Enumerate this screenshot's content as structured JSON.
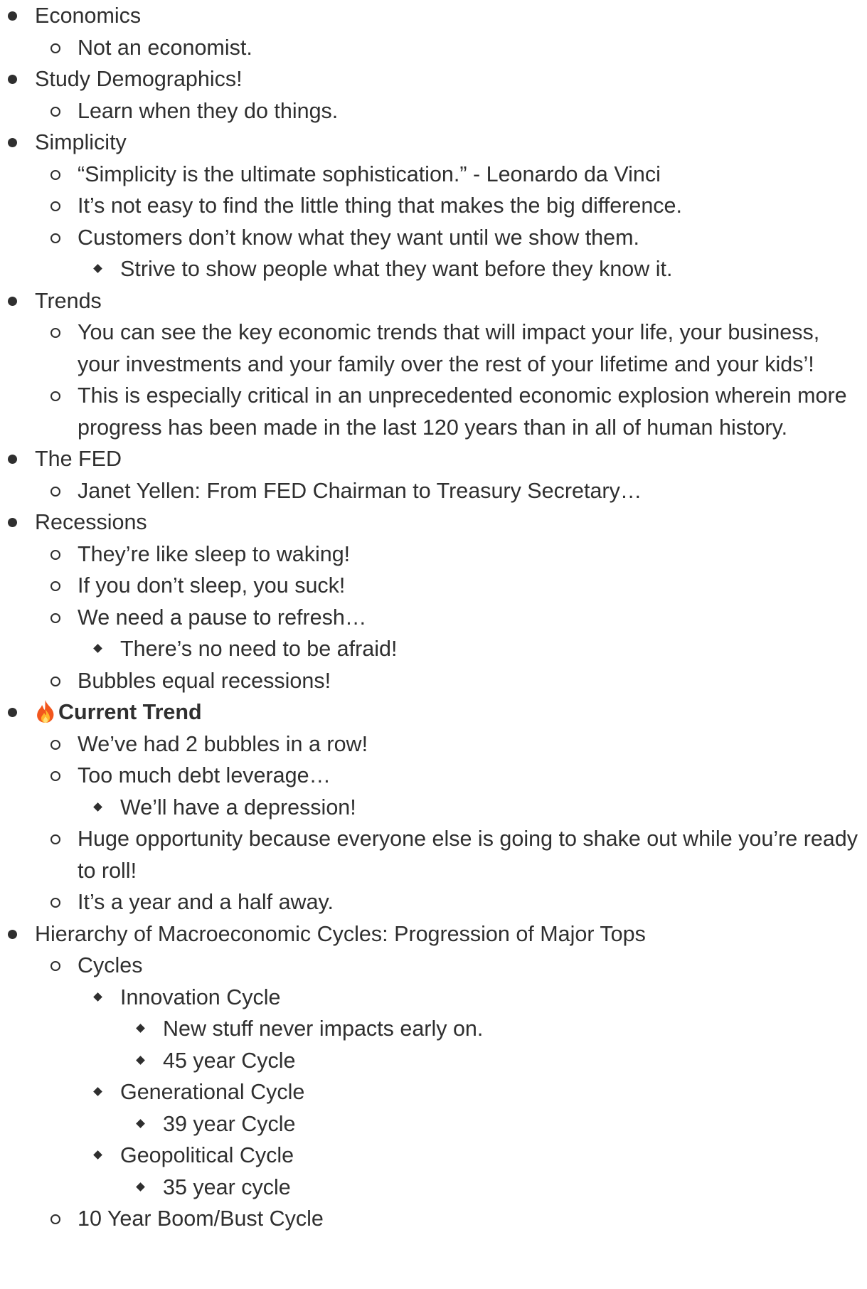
{
  "outline": [
    {
      "level": 1,
      "text": "Economics"
    },
    {
      "level": 2,
      "text": "Not an economist."
    },
    {
      "level": 1,
      "text": "Study Demographics!"
    },
    {
      "level": 2,
      "text": "Learn when they do things."
    },
    {
      "level": 1,
      "text": "Simplicity"
    },
    {
      "level": 2,
      "text": "“Simplicity is the ultimate sophistication.” - Leonardo da Vinci"
    },
    {
      "level": 2,
      "text": "It’s not easy to find the little thing that makes the big difference."
    },
    {
      "level": 2,
      "text": "Customers don’t know what they want until we show them."
    },
    {
      "level": 3,
      "text": "Strive to show people what they want before they know it."
    },
    {
      "level": 1,
      "text": "Trends"
    },
    {
      "level": 2,
      "text": "You can see the key economic trends that will impact your life, your business, your investments and your family over the rest of your lifetime and your kids’!"
    },
    {
      "level": 2,
      "text": "This is especially critical in an unprecedented economic explosion wherein more progress has been made in the last 120 years than in all of human history."
    },
    {
      "level": 1,
      "text": "The FED"
    },
    {
      "level": 2,
      "text": "Janet Yellen: From FED Chairman to Treasury Secretary…"
    },
    {
      "level": 1,
      "text": "Recessions"
    },
    {
      "level": 2,
      "text": "They’re like sleep to waking!"
    },
    {
      "level": 2,
      "text": "If you don’t sleep, you suck!"
    },
    {
      "level": 2,
      "text": "We need a pause to refresh…"
    },
    {
      "level": 3,
      "text": "There’s no need to be afraid!"
    },
    {
      "level": 2,
      "text": "Bubbles equal recessions!"
    },
    {
      "level": 1,
      "text": "Current Trend",
      "bold": true,
      "icon": "flame-icon"
    },
    {
      "level": 2,
      "text": "We’ve had 2 bubbles in a row!"
    },
    {
      "level": 2,
      "text": "Too much debt leverage…"
    },
    {
      "level": 3,
      "text": "We’ll have a depression!"
    },
    {
      "level": 2,
      "text": "Huge opportunity because everyone else is going to shake out while you’re ready to roll!"
    },
    {
      "level": 2,
      "text": "It’s a year and a half away."
    },
    {
      "level": 1,
      "text": "Hierarchy of Macroeconomic Cycles: Progression of Major Tops"
    },
    {
      "level": 2,
      "text": "Cycles"
    },
    {
      "level": 3,
      "text": "Innovation Cycle"
    },
    {
      "level": 4,
      "text": "New stuff never impacts early on."
    },
    {
      "level": 4,
      "text": "45 year Cycle"
    },
    {
      "level": 3,
      "text": "Generational Cycle"
    },
    {
      "level": 4,
      "text": "39 year Cycle"
    },
    {
      "level": 3,
      "text": "Geopolitical Cycle"
    },
    {
      "level": 4,
      "text": "35 year cycle"
    },
    {
      "level": 2,
      "text": "10 Year Boom/Bust Cycle"
    }
  ],
  "colors": {
    "text": "#2f2f2f",
    "background": "#ffffff"
  }
}
